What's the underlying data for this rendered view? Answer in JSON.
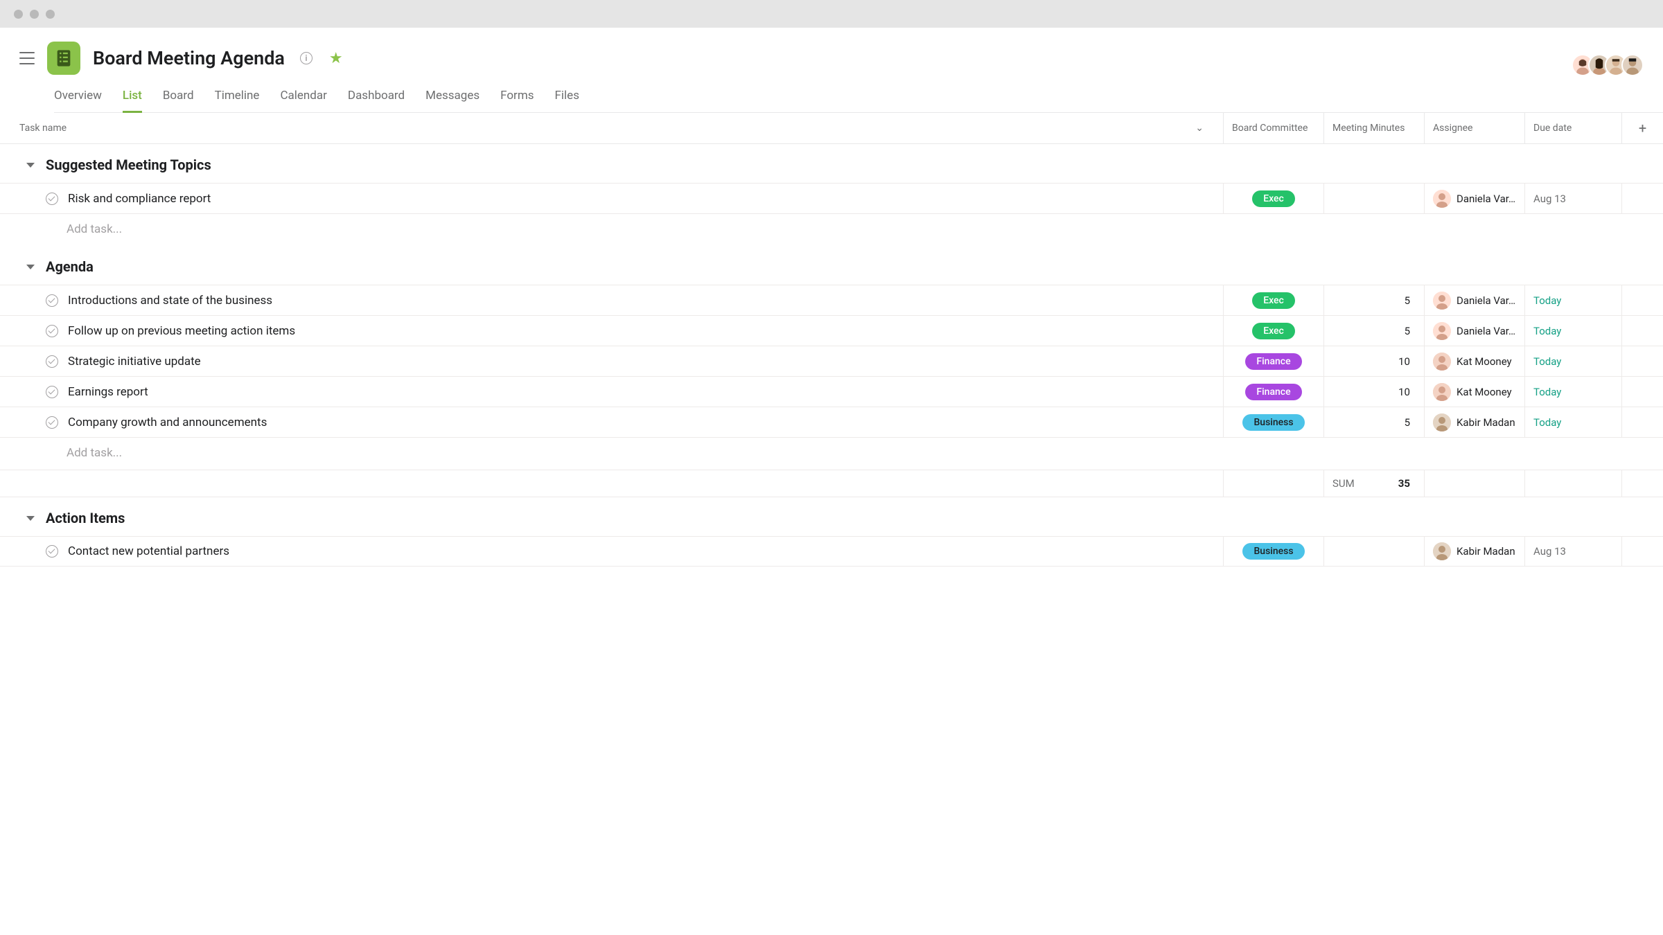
{
  "project": {
    "title": "Board Meeting Agenda"
  },
  "tabs": [
    "Overview",
    "List",
    "Board",
    "Timeline",
    "Calendar",
    "Dashboard",
    "Messages",
    "Forms",
    "Files"
  ],
  "activeTab": "List",
  "columns": {
    "taskname": "Task name",
    "committee": "Board Committee",
    "minutes": "Meeting Minutes",
    "assignee": "Assignee",
    "duedate": "Due date"
  },
  "committees": {
    "exec": "Exec",
    "finance": "Finance",
    "business": "Business"
  },
  "assignees": {
    "daniela": {
      "name": "Daniela Var...",
      "bg": "#ffdfd3"
    },
    "kat": {
      "name": "Kat Mooney",
      "bg": "#f4d3c4"
    },
    "kabir": {
      "name": "Kabir Madan",
      "bg": "#e4d4c3"
    }
  },
  "sections": [
    {
      "title": "Suggested Meeting Topics",
      "tasks": [
        {
          "name": "Risk and compliance report",
          "committee": "exec",
          "minutes": "",
          "assignee": "daniela",
          "due": "Aug 13",
          "dueClass": "due-date"
        }
      ],
      "addTaskLabel": "Add task...",
      "hasSum": false
    },
    {
      "title": "Agenda",
      "tasks": [
        {
          "name": "Introductions and state of the business",
          "committee": "exec",
          "minutes": "5",
          "assignee": "daniela",
          "due": "Today",
          "dueClass": "due-today"
        },
        {
          "name": "Follow up on previous meeting action items",
          "committee": "exec",
          "minutes": "5",
          "assignee": "daniela",
          "due": "Today",
          "dueClass": "due-today"
        },
        {
          "name": "Strategic initiative update",
          "committee": "finance",
          "minutes": "10",
          "assignee": "kat",
          "due": "Today",
          "dueClass": "due-today"
        },
        {
          "name": "Earnings report",
          "committee": "finance",
          "minutes": "10",
          "assignee": "kat",
          "due": "Today",
          "dueClass": "due-today"
        },
        {
          "name": "Company growth and announcements",
          "committee": "business",
          "minutes": "5",
          "assignee": "kabir",
          "due": "Today",
          "dueClass": "due-today"
        }
      ],
      "addTaskLabel": "Add task...",
      "hasSum": true,
      "sumLabel": "SUM",
      "sumValue": "35"
    },
    {
      "title": "Action Items",
      "tasks": [
        {
          "name": "Contact new potential partners",
          "committee": "business",
          "minutes": "",
          "assignee": "kabir",
          "due": "Aug 13",
          "dueClass": "due-date"
        }
      ],
      "hasSum": false
    }
  ]
}
